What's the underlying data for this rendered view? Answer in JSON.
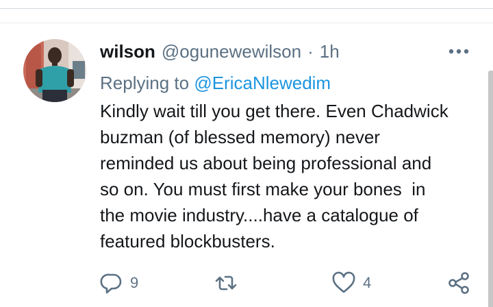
{
  "tweet": {
    "author_name": "wilson",
    "author_handle": "@ogunewewilson",
    "separator": "·",
    "timestamp": "1h",
    "replying_prefix": "Replying to",
    "replying_to": "@EricaNlewedim",
    "text_lines": [
      "Kindly wait till you get there. Even Chadwick",
      "buzman (of blessed memory) never",
      "reminded us about being professional and",
      "so on. You must first make your bones  in",
      "the movie industry....have a catalogue of",
      "featured blockbusters."
    ]
  },
  "actions": {
    "reply": {
      "icon": "reply-icon",
      "count": "9"
    },
    "retweet": {
      "icon": "retweet-icon",
      "count": ""
    },
    "like": {
      "icon": "like-icon",
      "count": "4"
    },
    "share": {
      "icon": "share-icon"
    }
  },
  "menu": {
    "icon": "more-icon"
  },
  "colors": {
    "text_primary": "#14171a",
    "text_secondary": "#5b7083",
    "link": "#1b95e0",
    "icon": "#5b7083",
    "divider": "#cfd9de"
  }
}
